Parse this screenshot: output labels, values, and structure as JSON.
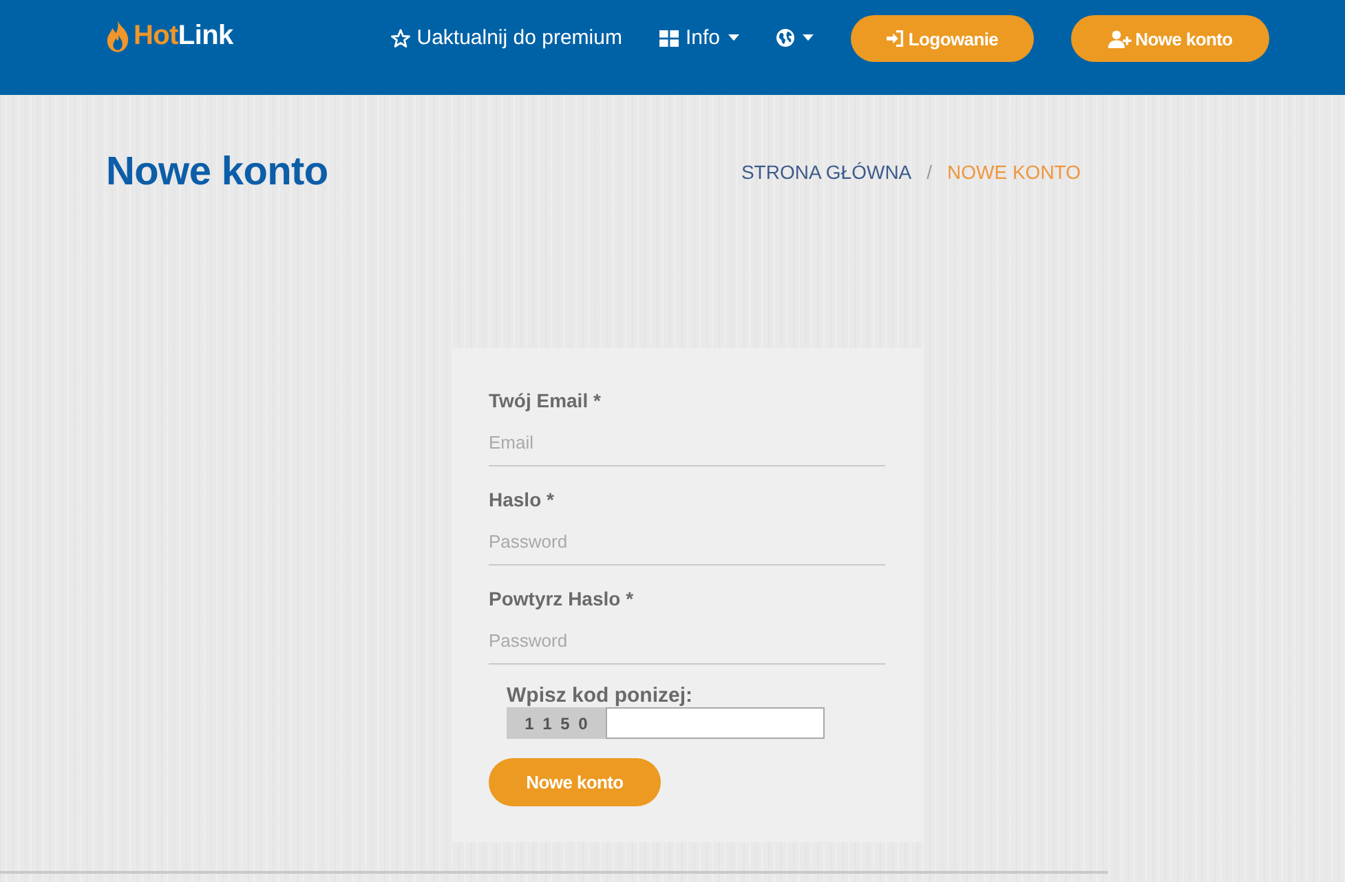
{
  "header": {
    "logo": [
      "Hot",
      "Link"
    ],
    "nav": [
      {
        "kind": "upgrade",
        "label": "Uaktualnij do premium",
        "dropdown": false
      },
      {
        "kind": "menu",
        "label": "Info",
        "dropdown": true
      },
      {
        "kind": "language",
        "dropdown": true
      }
    ],
    "buttons": [
      {
        "kind": "login",
        "label": "Logowanie"
      },
      {
        "kind": "register",
        "label": "Nowe konto"
      }
    ]
  },
  "page_title": "Nowe konto",
  "breadcrumb": {
    "separator": "/",
    "items": [
      {
        "label": "STRONA GŁÓWNA",
        "current": false
      },
      {
        "label": "NOWE KONTO",
        "current": true
      }
    ]
  },
  "form": {
    "fields": [
      {
        "label": "Twój Email *",
        "placeholder": "Email"
      },
      {
        "label": "Haslo *",
        "placeholder": "Password"
      },
      {
        "label": "Powtyrz Haslo *",
        "placeholder": "Password"
      }
    ],
    "captcha": {
      "label": "Wpisz kod ponizej:",
      "code": "1 1 5 0"
    },
    "submit": "Nowe konto"
  }
}
